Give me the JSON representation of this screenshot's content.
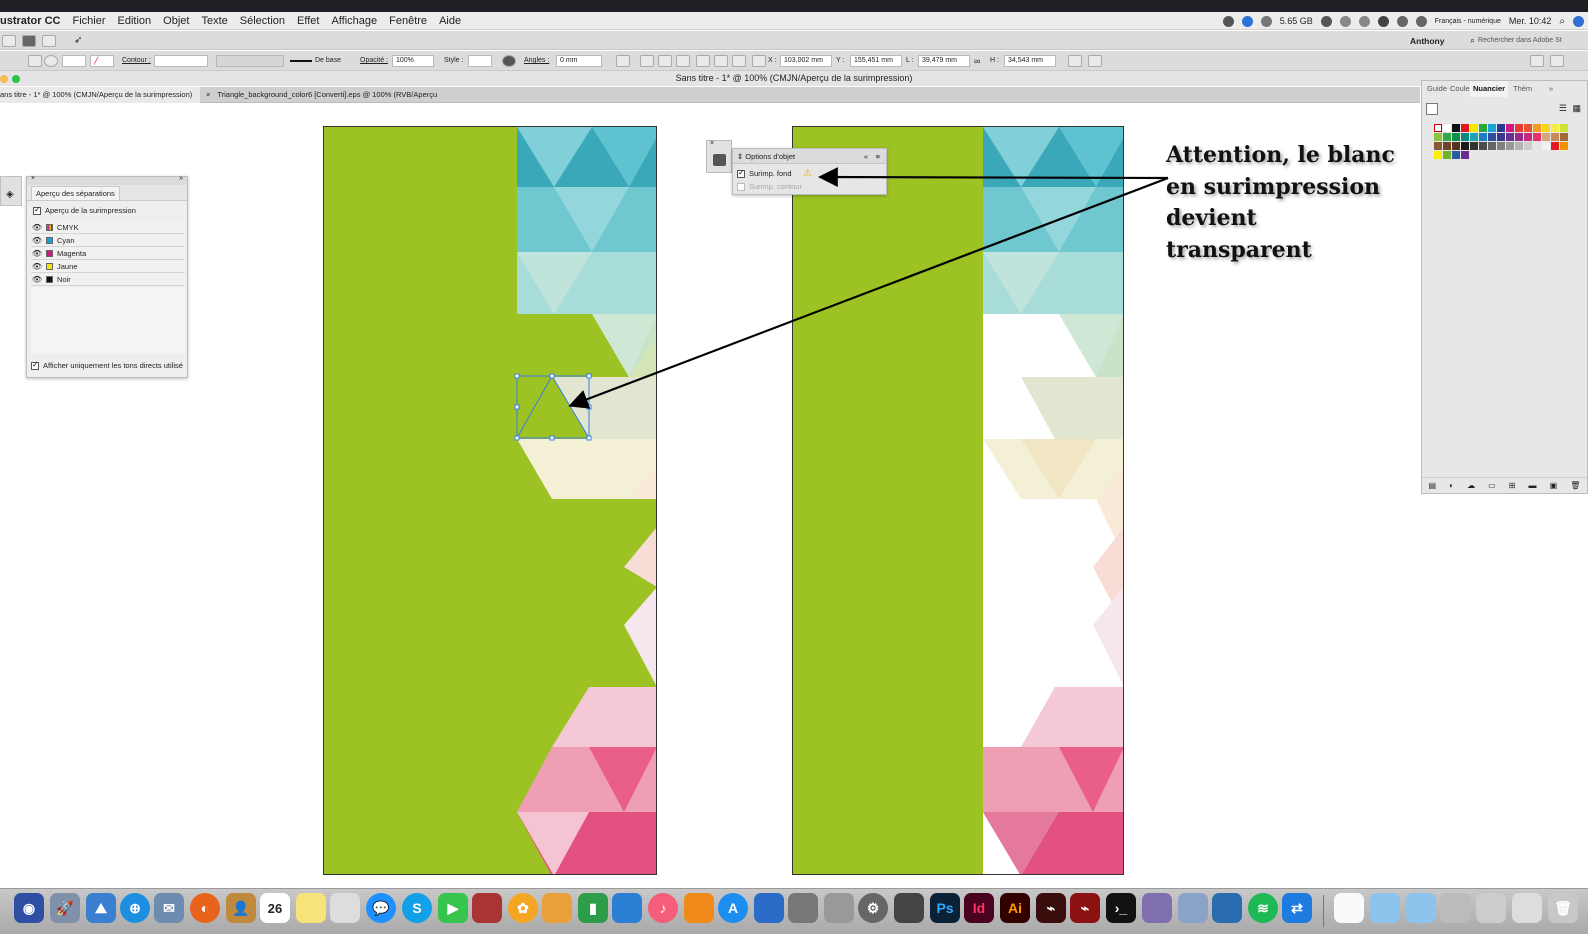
{
  "menubar": {
    "app_name": "ustrator CC",
    "items": [
      "Fichier",
      "Edition",
      "Objet",
      "Texte",
      "Sélection",
      "Effet",
      "Affichage",
      "Fenêtre",
      "Aide"
    ],
    "status": {
      "memory": "5.65 GB",
      "keyboard": "Français - numérique",
      "clock": "Mer. 10:42"
    }
  },
  "control_bar": {
    "user": "Anthony",
    "search_placeholder": "Rechercher dans Adobe St",
    "contour_label": "Contour :",
    "stroke_style": "De base",
    "opacity_label": "Opacité :",
    "opacity_value": "100%",
    "style_label": "Style :",
    "angles_label": "Angles :",
    "angles_value": "0 mm",
    "x_label": "X :",
    "x_value": "103,002 mm",
    "y_label": "Y :",
    "y_value": "155,451 mm",
    "w_label": "L :",
    "w_value": "39,479 mm",
    "h_label": "H :",
    "h_value": "34,543 mm"
  },
  "window": {
    "title": "Sans titre - 1* @ 100% (CMJN/Aperçu de la surimpression)",
    "tabs": [
      {
        "label": "ans titre - 1* @ 100% (CMJN/Aperçu de la surimpression)",
        "active": true
      },
      {
        "label": "Triangle_background_color6 [Converti].eps @ 100% (RVB/Aperçu GPU)",
        "active": false
      }
    ],
    "tab_close": "×"
  },
  "separations_panel": {
    "title": "Aperçu des séparations",
    "overprint_preview_label": "Aperçu de la surimpression",
    "overprint_preview_checked": true,
    "plates": [
      {
        "name": "CMYK",
        "color": "#3a3a8a"
      },
      {
        "name": "Cyan",
        "color": "#16a0d8"
      },
      {
        "name": "Magenta",
        "color": "#d4157e"
      },
      {
        "name": "Jaune",
        "color": "#f3e60e"
      },
      {
        "name": "Noir",
        "color": "#111111"
      }
    ],
    "footer_label": "Afficher uniquement les tons directs utilisé",
    "footer_checked": true
  },
  "object_options_panel": {
    "title": "Options d'objet",
    "collapse": "«",
    "fill_overprint_label": "Surimp. fond",
    "fill_overprint_checked": true,
    "stroke_overprint_label": "Surimp. contour",
    "stroke_overprint_checked": false,
    "warning_icon": "warning-icon"
  },
  "swatches_panel": {
    "tabs": [
      "Guide",
      "Coule",
      "Nuancier",
      "Thèm"
    ],
    "active_tab": "Nuancier",
    "expand": "»"
  },
  "annotation": {
    "lines": [
      "Attention, le blanc",
      "en surimpression",
      "devient",
      "transparent"
    ]
  },
  "colors": {
    "artboard_green": "#9dc223",
    "selection": "#3d7fe0",
    "warning": "#f0b400"
  },
  "dock": {
    "calendar_day": "26",
    "labels": [
      "Ps",
      "Id",
      "Ai"
    ]
  }
}
